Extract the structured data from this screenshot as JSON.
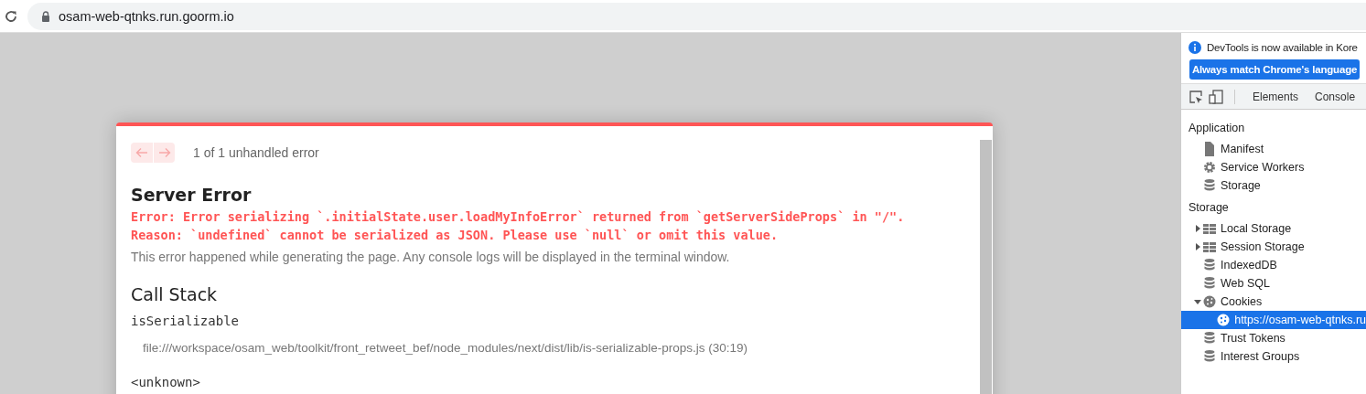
{
  "browser": {
    "url": "osam-web-qtnks.run.goorm.io"
  },
  "error_overlay": {
    "pager": "1 of 1 unhandled error",
    "title": "Server Error",
    "messages": [
      "Error: Error serializing `.initialState.user.loadMyInfoError` returned from `getServerSideProps` in \"/\".",
      "Reason: `undefined` cannot be serialized as JSON. Please use `null` or omit this value."
    ],
    "description": "This error happened while generating the page. Any console logs will be displayed in the terminal window.",
    "stack_title": "Call Stack",
    "frames": [
      {
        "function": "isSerializable",
        "location": "file:///workspace/osam_web/toolkit/front_retweet_bef/node_modules/next/dist/lib/is-serializable-props.js (30:19)"
      },
      {
        "function": "<unknown>"
      }
    ]
  },
  "devtools": {
    "notice": "DevTools is now available in Kore",
    "notice_button": "Always match Chrome's language",
    "tabs": [
      {
        "label": "Elements",
        "selected": false
      },
      {
        "label": "Console",
        "selected": false
      }
    ],
    "sections": [
      {
        "title": "Application",
        "items": [
          {
            "kind": "file",
            "label": "Manifest",
            "selected": false
          },
          {
            "kind": "gear",
            "label": "Service Workers",
            "selected": false
          },
          {
            "kind": "database",
            "label": "Storage",
            "selected": false
          }
        ]
      },
      {
        "title": "Storage",
        "items": [
          {
            "kind": "grid",
            "label": "Local Storage",
            "expanded": false,
            "selected": false
          },
          {
            "kind": "grid",
            "label": "Session Storage",
            "expanded": false,
            "selected": false
          },
          {
            "kind": "database",
            "label": "IndexedDB",
            "selected": false
          },
          {
            "kind": "database",
            "label": "Web SQL",
            "selected": false
          },
          {
            "kind": "cookie",
            "label": "Cookies",
            "expanded": true,
            "selected": false,
            "children": [
              {
                "kind": "cookie",
                "label": "https://osam-web-qtnks.ru",
                "selected": true
              }
            ]
          },
          {
            "kind": "database",
            "label": "Trust Tokens",
            "selected": false
          },
          {
            "kind": "database",
            "label": "Interest Groups",
            "selected": false
          }
        ]
      }
    ]
  }
}
